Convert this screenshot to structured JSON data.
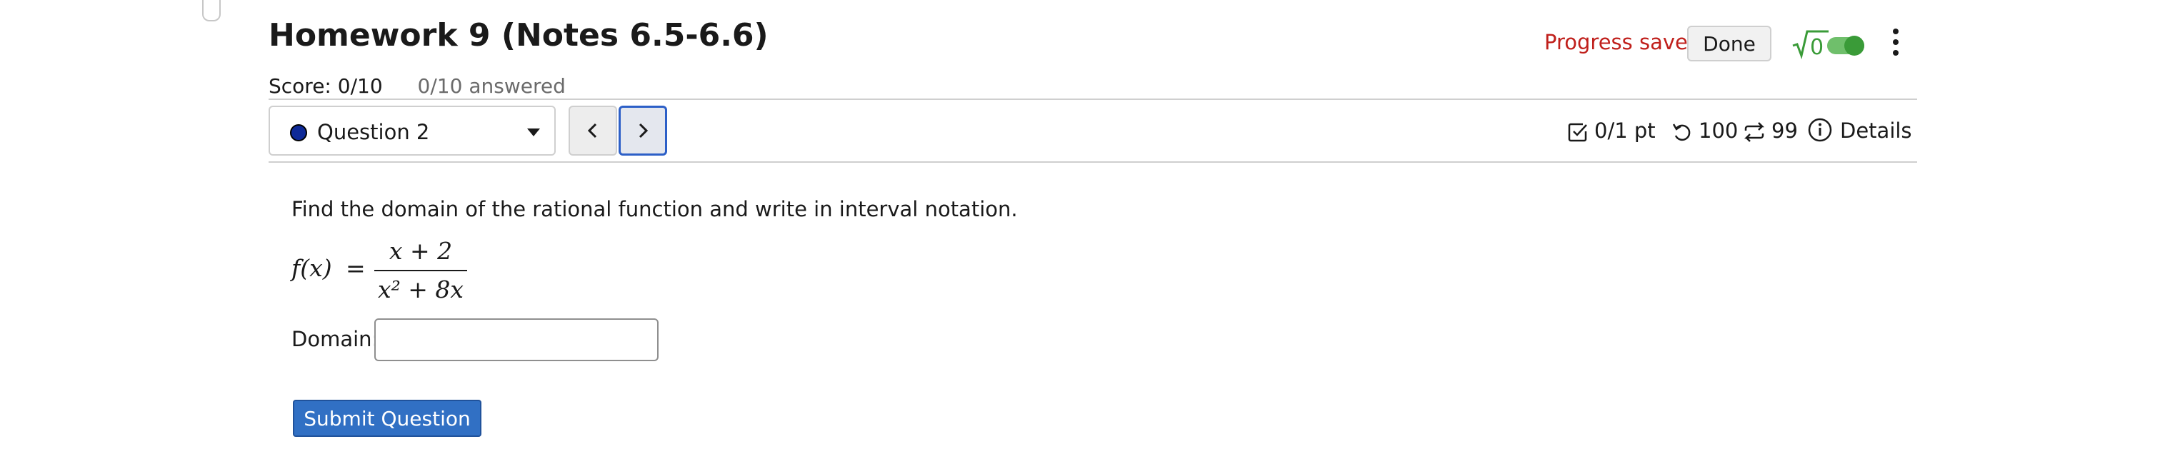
{
  "assignment": {
    "title": "Homework 9 (Notes 6.5-6.6)",
    "score": "Score: 0/10",
    "answered": "0/10 answered"
  },
  "header_actions": {
    "progress_text": "Progress saved",
    "done_label": "Done",
    "math_toggle_symbol": "√0",
    "math_toggle_on": true,
    "accent_color": "#3a9b38",
    "progress_color": "#c0201c"
  },
  "question_nav": {
    "selected_question": "Question 2",
    "prev_icon": "chevron-left-icon",
    "next_icon": "chevron-right-icon"
  },
  "question_stats": {
    "points": "0/1 pt",
    "retries": "100",
    "attempts": "99",
    "details_label": "Details"
  },
  "question": {
    "prompt": "Find the domain of the rational function and write in interval notation.",
    "function_lhs": "f(x)",
    "equals": "=",
    "numerator": "x + 2",
    "denominator": "x² + 8x",
    "domain_label": "Domain:",
    "domain_value": "",
    "submit_label": "Submit Question"
  },
  "colors": {
    "primary_button": "#3170c4",
    "nav_focus": "#2c5fc7",
    "question_dot": "#0e2a98"
  }
}
